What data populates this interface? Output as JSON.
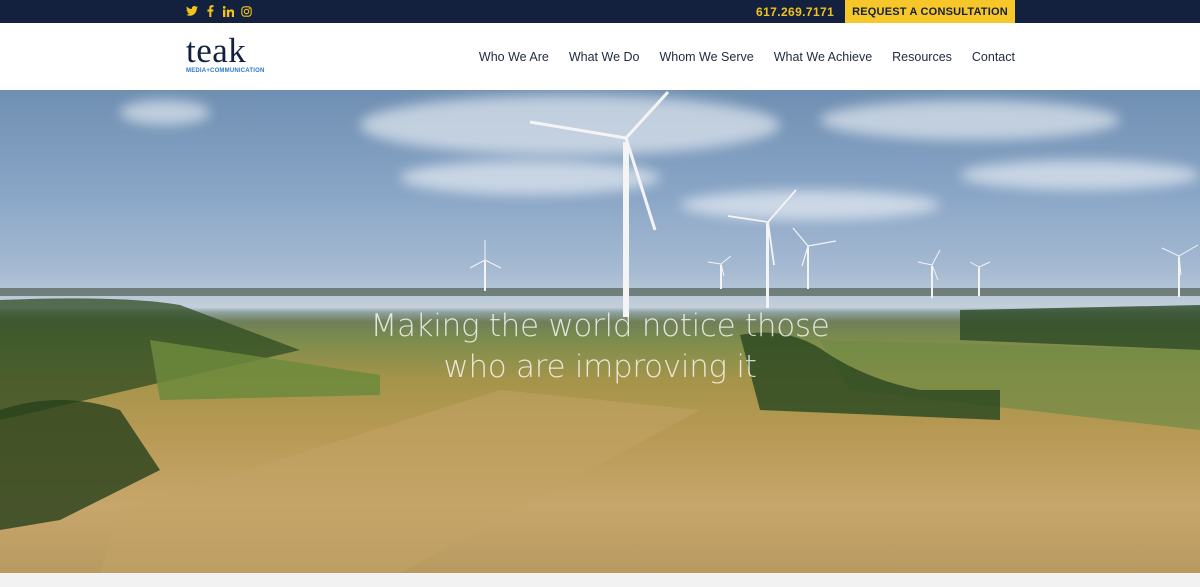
{
  "topbar": {
    "social_icons": [
      "twitter-icon",
      "facebook-icon",
      "linkedin-icon",
      "instagram-icon"
    ],
    "social_glyphs": [
      "🐦",
      "f",
      "in",
      "◎"
    ],
    "phone": "617.269.7171",
    "cta_label": "REQUEST A CONSULTATION"
  },
  "brand": {
    "name": "teak",
    "tagline": "MEDIA+COMMUNICATION"
  },
  "nav": {
    "items": [
      "Who We Are",
      "What We Do",
      "Whom We Serve",
      "What We Achieve",
      "Resources",
      "Contact"
    ]
  },
  "hero": {
    "headline_line1": "Making the world notice those",
    "headline_line2": "who are improving it"
  },
  "colors": {
    "navy": "#13213f",
    "gold": "#f7c72a",
    "link_blue": "#2b78c5"
  }
}
